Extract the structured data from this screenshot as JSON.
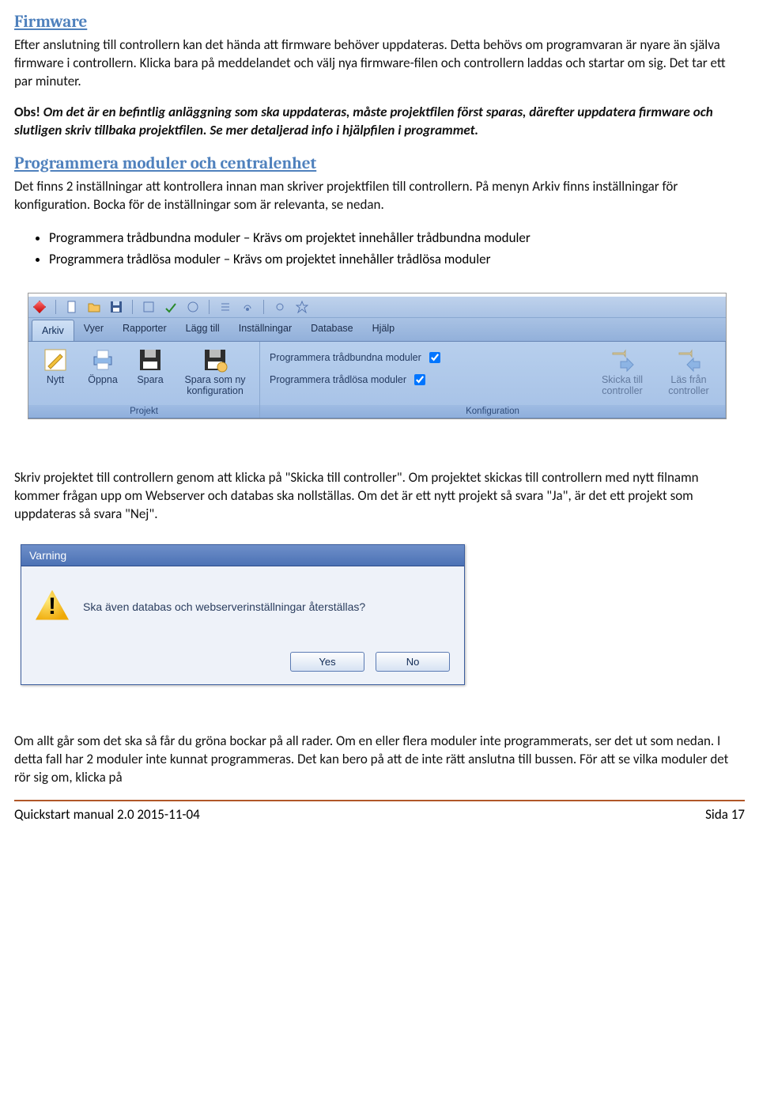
{
  "section1": {
    "title": "Firmware",
    "p1": "Efter anslutning till controllern kan det hända att firmware behöver uppdateras. Detta behövs om programvaran är nyare än själva firmware i controllern. Klicka bara på meddelandet och välj nya firmware-filen och controllern laddas och startar om sig. Det tar ett par minuter.",
    "obs_label": "Obs!",
    "obs": "Om det är en befintlig anläggning som ska uppdateras, måste projektfilen först sparas, därefter uppdatera firmware och slutligen skriv tillbaka projektfilen. Se mer detaljerad info i hjälpfilen i programmet."
  },
  "section2": {
    "title": "Programmera moduler och centralenhet",
    "p1": "Det finns 2 inställningar att kontrollera innan man skriver projektfilen till controllern. På menyn Arkiv finns inställningar för konfiguration. Bocka för de inställningar som är relevanta, se nedan.",
    "bullets": [
      "Programmera trådbundna moduler – Krävs om projektet innehåller trådbundna moduler",
      "Programmera trådlösa moduler – Krävs om projektet innehåller trådlösa moduler"
    ]
  },
  "ribbon": {
    "tabs": [
      "Arkiv",
      "Vyer",
      "Rapporter",
      "Lägg till",
      "Inställningar",
      "Database",
      "Hjälp"
    ],
    "active_tab": "Arkiv",
    "projekt_group": "Projekt",
    "konfig_group": "Konfiguration",
    "btn_nytt": "Nytt",
    "btn_oppna": "Öppna",
    "btn_spara": "Spara",
    "btn_spara_ny": "Spara som ny konfiguration",
    "chk_tradbundna": "Programmera trådbundna moduler",
    "chk_tradlosa": "Programmera trådlösa moduler",
    "btn_skicka": "Skicka till controller",
    "btn_las": "Läs från controller"
  },
  "p_after_ribbon": "Skriv projektet till controllern genom att klicka på \"Skicka till controller\". Om projektet skickas till controllern med nytt filnamn kommer frågan upp om Webserver och databas ska nollställas. Om det är ett nytt projekt så svara \"Ja\", är det ett projekt som uppdateras så svara \"Nej\".",
  "dialog": {
    "title": "Varning",
    "message": "Ska även databas och webserverinställningar återställas?",
    "yes": "Yes",
    "no": "No"
  },
  "p_end": "Om allt går som det ska så får du gröna bockar på all rader. Om en eller flera moduler inte programmerats, ser det ut som nedan. I detta fall har 2 moduler inte kunnat programmeras. Det kan bero på att de inte rätt anslutna till bussen. För att se vilka moduler det rör sig om, klicka på",
  "footer": {
    "left": "Quickstart manual 2.0 2015-11-04",
    "right": "Sida 17"
  }
}
